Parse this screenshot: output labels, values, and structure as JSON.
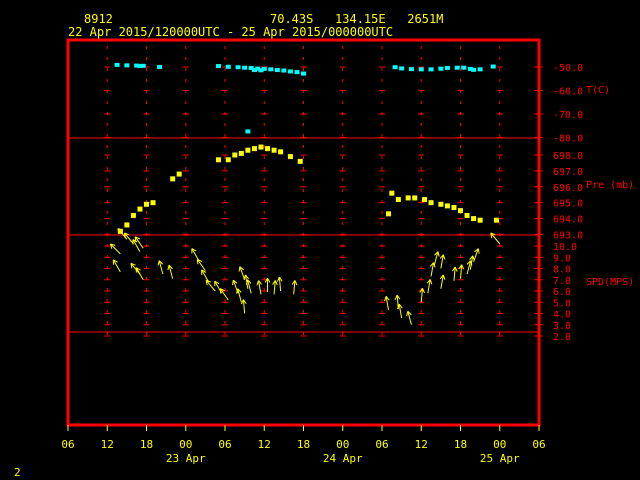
{
  "header": {
    "station_id": "8912",
    "location": "70.43S   134.15E   2651M",
    "time_range": "22 Apr 2015/120000UTC - 25 Apr 2015/000000UTC"
  },
  "footer": {
    "page_number": "2"
  },
  "colors": {
    "frame": "#ff0000",
    "axis": "#ffff00",
    "temp": "#00ffff",
    "pressure": "#ffff00",
    "wind": "#ffff00"
  },
  "chart_data": {
    "type": "scatter",
    "x_unit": "hours since 22 Apr 2015 06 UTC",
    "x_tick_labels": [
      "06",
      "12",
      "18",
      "00",
      "06",
      "12",
      "18",
      "00",
      "06",
      "12",
      "18",
      "00",
      "06"
    ],
    "x_date_labels": [
      {
        "label": "23 Apr",
        "x": 18
      },
      {
        "label": "24 Apr",
        "x": 42
      },
      {
        "label": "25 Apr",
        "x": 66
      }
    ],
    "xlim": [
      0,
      72
    ],
    "panels": [
      {
        "name": "temperature",
        "unit_label": "T(C)",
        "tick_labels": [
          "-50.0",
          "-60.0",
          "-70.0",
          "-80.0"
        ],
        "ylim": [
          -80,
          -50
        ],
        "points": [
          {
            "x": 7.5,
            "y": -49.1
          },
          {
            "x": 9,
            "y": -49.3
          },
          {
            "x": 10.5,
            "y": -49.4
          },
          {
            "x": 11,
            "y": -49.6
          },
          {
            "x": 11.5,
            "y": -49.5
          },
          {
            "x": 14,
            "y": -50.0
          },
          {
            "x": 23,
            "y": -49.6
          },
          {
            "x": 24.5,
            "y": -49.9
          },
          {
            "x": 26,
            "y": -50.1
          },
          {
            "x": 27,
            "y": -50.3
          },
          {
            "x": 28,
            "y": -50.4
          },
          {
            "x": 29,
            "y": -50.7
          },
          {
            "x": 30,
            "y": -50.8
          },
          {
            "x": 31,
            "y": -51.0
          },
          {
            "x": 32,
            "y": -51.3
          },
          {
            "x": 33,
            "y": -51.5
          },
          {
            "x": 34,
            "y": -51.9
          },
          {
            "x": 35,
            "y": -52.2
          },
          {
            "x": 36,
            "y": -52.8
          },
          {
            "x": 28.5,
            "y": -51.3
          },
          {
            "x": 29.5,
            "y": -51.4
          },
          {
            "x": 27.5,
            "y": -77.4
          },
          {
            "x": 50,
            "y": -50.1
          },
          {
            "x": 51,
            "y": -50.6
          },
          {
            "x": 52.5,
            "y": -50.9
          },
          {
            "x": 54,
            "y": -51.0
          },
          {
            "x": 55.5,
            "y": -51.0
          },
          {
            "x": 57,
            "y": -50.7
          },
          {
            "x": 58,
            "y": -50.4
          },
          {
            "x": 59.5,
            "y": -50.3
          },
          {
            "x": 60.5,
            "y": -50.3
          },
          {
            "x": 61.5,
            "y": -50.8
          },
          {
            "x": 62,
            "y": -51.2
          },
          {
            "x": 63,
            "y": -51.0
          },
          {
            "x": 65,
            "y": -49.8
          }
        ]
      },
      {
        "name": "pressure",
        "unit_label": "Pre (mb)",
        "tick_labels": [
          "698.0",
          "697.0",
          "696.0",
          "695.0",
          "694.0",
          "693.0"
        ],
        "ylim": [
          693,
          698
        ],
        "points": [
          {
            "x": 8,
            "y": 693.2
          },
          {
            "x": 9,
            "y": 693.6
          },
          {
            "x": 10,
            "y": 694.2
          },
          {
            "x": 11,
            "y": 694.6
          },
          {
            "x": 12,
            "y": 694.9
          },
          {
            "x": 13,
            "y": 695.0
          },
          {
            "x": 16,
            "y": 696.5
          },
          {
            "x": 17,
            "y": 696.8
          },
          {
            "x": 23,
            "y": 697.7
          },
          {
            "x": 24.5,
            "y": 697.7
          },
          {
            "x": 25.5,
            "y": 698.0
          },
          {
            "x": 26.5,
            "y": 698.1
          },
          {
            "x": 27.5,
            "y": 698.3
          },
          {
            "x": 28.5,
            "y": 698.4
          },
          {
            "x": 29.5,
            "y": 698.5
          },
          {
            "x": 30.5,
            "y": 698.4
          },
          {
            "x": 31.5,
            "y": 698.3
          },
          {
            "x": 32.5,
            "y": 698.2
          },
          {
            "x": 34,
            "y": 697.9
          },
          {
            "x": 35.5,
            "y": 697.6
          },
          {
            "x": 49.5,
            "y": 695.6
          },
          {
            "x": 50.5,
            "y": 695.2
          },
          {
            "x": 52,
            "y": 695.3
          },
          {
            "x": 53,
            "y": 695.3
          },
          {
            "x": 54.5,
            "y": 695.2
          },
          {
            "x": 55.5,
            "y": 695.0
          },
          {
            "x": 57,
            "y": 694.9
          },
          {
            "x": 58,
            "y": 694.8
          },
          {
            "x": 59,
            "y": 694.7
          },
          {
            "x": 60,
            "y": 694.5
          },
          {
            "x": 61,
            "y": 694.2
          },
          {
            "x": 62,
            "y": 694.0
          },
          {
            "x": 63,
            "y": 693.9
          },
          {
            "x": 65.5,
            "y": 693.9
          },
          {
            "x": 49,
            "y": 694.3
          }
        ]
      },
      {
        "name": "wind",
        "unit_label": "SPD(MPS)",
        "tick_labels": [
          "10.0",
          "9.0",
          "8.0",
          "7.0",
          "6.0",
          "5.0",
          "4.0",
          "3.0",
          "2.0"
        ],
        "ylim": [
          2,
          10
        ],
        "points": [
          {
            "x": 8,
            "y": 9.3,
            "dir": 315
          },
          {
            "x": 9,
            "y": 10.6,
            "dir": 320
          },
          {
            "x": 10,
            "y": 10.2,
            "dir": 320
          },
          {
            "x": 11,
            "y": 9.5,
            "dir": 330
          },
          {
            "x": 11.5,
            "y": 9.8,
            "dir": 325
          },
          {
            "x": 8,
            "y": 7.7,
            "dir": 330
          },
          {
            "x": 11,
            "y": 7.5,
            "dir": 320
          },
          {
            "x": 11.5,
            "y": 7.0,
            "dir": 330
          },
          {
            "x": 14.5,
            "y": 7.5,
            "dir": 345
          },
          {
            "x": 16,
            "y": 7.1,
            "dir": 345
          },
          {
            "x": 20,
            "y": 8.7,
            "dir": 330
          },
          {
            "x": 21,
            "y": 7.8,
            "dir": 325
          },
          {
            "x": 21.5,
            "y": 6.8,
            "dir": 330
          },
          {
            "x": 22.5,
            "y": 6.0,
            "dir": 320
          },
          {
            "x": 23.5,
            "y": 5.8,
            "dir": 330
          },
          {
            "x": 24.5,
            "y": 5.2,
            "dir": 325
          },
          {
            "x": 26,
            "y": 5.8,
            "dir": 340
          },
          {
            "x": 26.5,
            "y": 5.0,
            "dir": 345
          },
          {
            "x": 27,
            "y": 7.0,
            "dir": 340
          },
          {
            "x": 27.5,
            "y": 6.2,
            "dir": 350
          },
          {
            "x": 28,
            "y": 5.8,
            "dir": 345
          },
          {
            "x": 29.5,
            "y": 5.7,
            "dir": 350
          },
          {
            "x": 30.5,
            "y": 5.9,
            "dir": 0
          },
          {
            "x": 31.5,
            "y": 5.7,
            "dir": 5
          },
          {
            "x": 32.5,
            "y": 6.0,
            "dir": 355
          },
          {
            "x": 34.5,
            "y": 5.7,
            "dir": 5
          },
          {
            "x": 27,
            "y": 4.0,
            "dir": 355
          },
          {
            "x": 49,
            "y": 4.3,
            "dir": 350
          },
          {
            "x": 50.5,
            "y": 4.4,
            "dir": 355
          },
          {
            "x": 51,
            "y": 3.6,
            "dir": 350
          },
          {
            "x": 52.5,
            "y": 3.0,
            "dir": 345
          },
          {
            "x": 54,
            "y": 5.0,
            "dir": 5
          },
          {
            "x": 55,
            "y": 5.8,
            "dir": 10
          },
          {
            "x": 55.5,
            "y": 7.3,
            "dir": 10
          },
          {
            "x": 56,
            "y": 8.3,
            "dir": 15
          },
          {
            "x": 57,
            "y": 8.0,
            "dir": 10
          },
          {
            "x": 57,
            "y": 6.2,
            "dir": 10
          },
          {
            "x": 59,
            "y": 6.9,
            "dir": 5
          },
          {
            "x": 60,
            "y": 7.1,
            "dir": 5
          },
          {
            "x": 61,
            "y": 7.5,
            "dir": 15
          },
          {
            "x": 61.5,
            "y": 7.9,
            "dir": 10
          },
          {
            "x": 62,
            "y": 8.6,
            "dir": 20
          },
          {
            "x": 66,
            "y": 10.2,
            "dir": 320
          }
        ]
      }
    ]
  }
}
